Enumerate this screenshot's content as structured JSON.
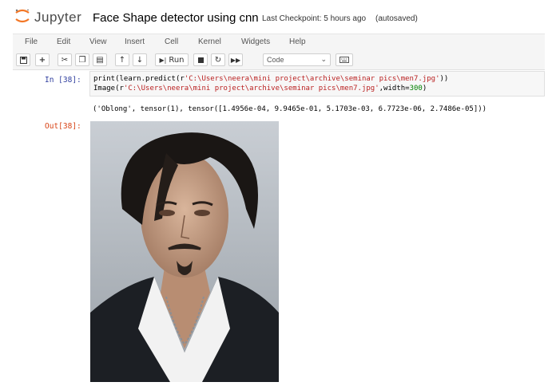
{
  "header": {
    "brand": "Jupyter",
    "notebook_title": "Face Shape detector using cnn",
    "checkpoint": "Last Checkpoint: 5 hours ago",
    "autosave": "(autosaved)"
  },
  "menu": [
    "File",
    "Edit",
    "View",
    "Insert",
    "Cell",
    "Kernel",
    "Widgets",
    "Help"
  ],
  "toolbar": {
    "run_label": "Run",
    "cell_type": "Code",
    "icons": [
      "save-icon",
      "add-cell-icon",
      "cut-icon",
      "copy-icon",
      "paste-icon",
      "move-up-icon",
      "move-down-icon",
      "run-icon",
      "stop-icon",
      "restart-icon",
      "fast-forward-icon",
      "keyboard-icon"
    ]
  },
  "cell": {
    "in_prompt": "In [38]:",
    "line1_fn": "print(learn.predict(r",
    "line1_str": "'C:\\Users\\neera\\mini project\\archive\\seminar pics\\men7.jpg'",
    "line1_end": "))",
    "line2_fn": "Image(r",
    "line2_str": "'C:\\Users\\neera\\mini project\\archive\\seminar pics\\men7.jpg'",
    "line2_mid": ",width=",
    "line2_num": "300",
    "line2_end": ")",
    "stdout": "('Oblong', tensor(1), tensor([1.4956e-04, 9.9465e-01, 5.1703e-03, 6.7723e-06, 2.7486e-05]))",
    "out_prompt": "Out[38]:"
  },
  "colors": {
    "in_prompt": "#303f9f",
    "out_prompt": "#d84315",
    "string": "#ba2121",
    "number": "#008000",
    "toolbar_bg": "#f5f5f5"
  }
}
